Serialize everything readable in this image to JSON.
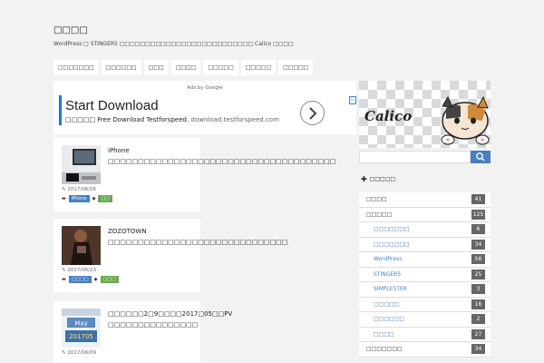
{
  "site": {
    "title": "□□□□",
    "description": "WordPress □ STINGER5 □□□□□□□□□□□□□□□□□□□□□□□□□□ Calico □□□□"
  },
  "nav": [
    {
      "label": "□□□□□□□"
    },
    {
      "label": "□□□□□□"
    },
    {
      "label": "□□□"
    },
    {
      "label": "□□□□"
    },
    {
      "label": "□□□□□"
    },
    {
      "label": "□□□□□"
    },
    {
      "label": "□□□□□"
    }
  ],
  "ad": {
    "by": "Ads by Google",
    "headline": "Start Download",
    "sub": "□□□□□ Free Download Testforspeed.",
    "url": "download.testforspeed.com"
  },
  "posts": [
    {
      "title": "iPhone □□□□□□□□□□□□□□□□□□□□□□□□□□□□□□□□□□□□□□",
      "date": "2017/06/26",
      "tags": [
        "iPhone",
        "□□"
      ]
    },
    {
      "title": "ZOZOTOWN □□□□□□□□□□□□□□□□□□□□□□□□□□□□□□",
      "date": "2017/06/23",
      "tags": [
        "□□□□",
        "□□□"
      ]
    },
    {
      "title": "□□□□□□2□9□□□□2017□05□□PV □□□□□□□□□□□□□□□",
      "date": "2017/06/09",
      "tags": []
    }
  ],
  "thumb3": {
    "month": "May",
    "year": "201705"
  },
  "banner": {
    "label": "Calico"
  },
  "sidebar": {
    "category_heading": "□□□□□",
    "categories": [
      {
        "name": "□□□□",
        "count": "41",
        "sub": false
      },
      {
        "name": "□□□□□",
        "count": "125",
        "sub": false
      },
      {
        "name": "□□□□□□□",
        "count": "6",
        "sub": true
      },
      {
        "name": "□□□□□□□",
        "count": "34",
        "sub": true
      },
      {
        "name": "WordPress",
        "count": "56",
        "sub": true
      },
      {
        "name": "STINGER5",
        "count": "25",
        "sub": true
      },
      {
        "name": "SIMPLESTER",
        "count": "3",
        "sub": true
      },
      {
        "name": "□□□□□",
        "count": "16",
        "sub": true
      },
      {
        "name": "□□□□□□",
        "count": "2",
        "sub": true
      },
      {
        "name": "□□□□",
        "count": "27",
        "sub": true
      },
      {
        "name": "□□□□□□□",
        "count": "34",
        "sub": false
      }
    ]
  },
  "colors": {
    "accent": "#4a7fbf",
    "tag_green": "#6aa84f",
    "count_bg": "#666666"
  }
}
